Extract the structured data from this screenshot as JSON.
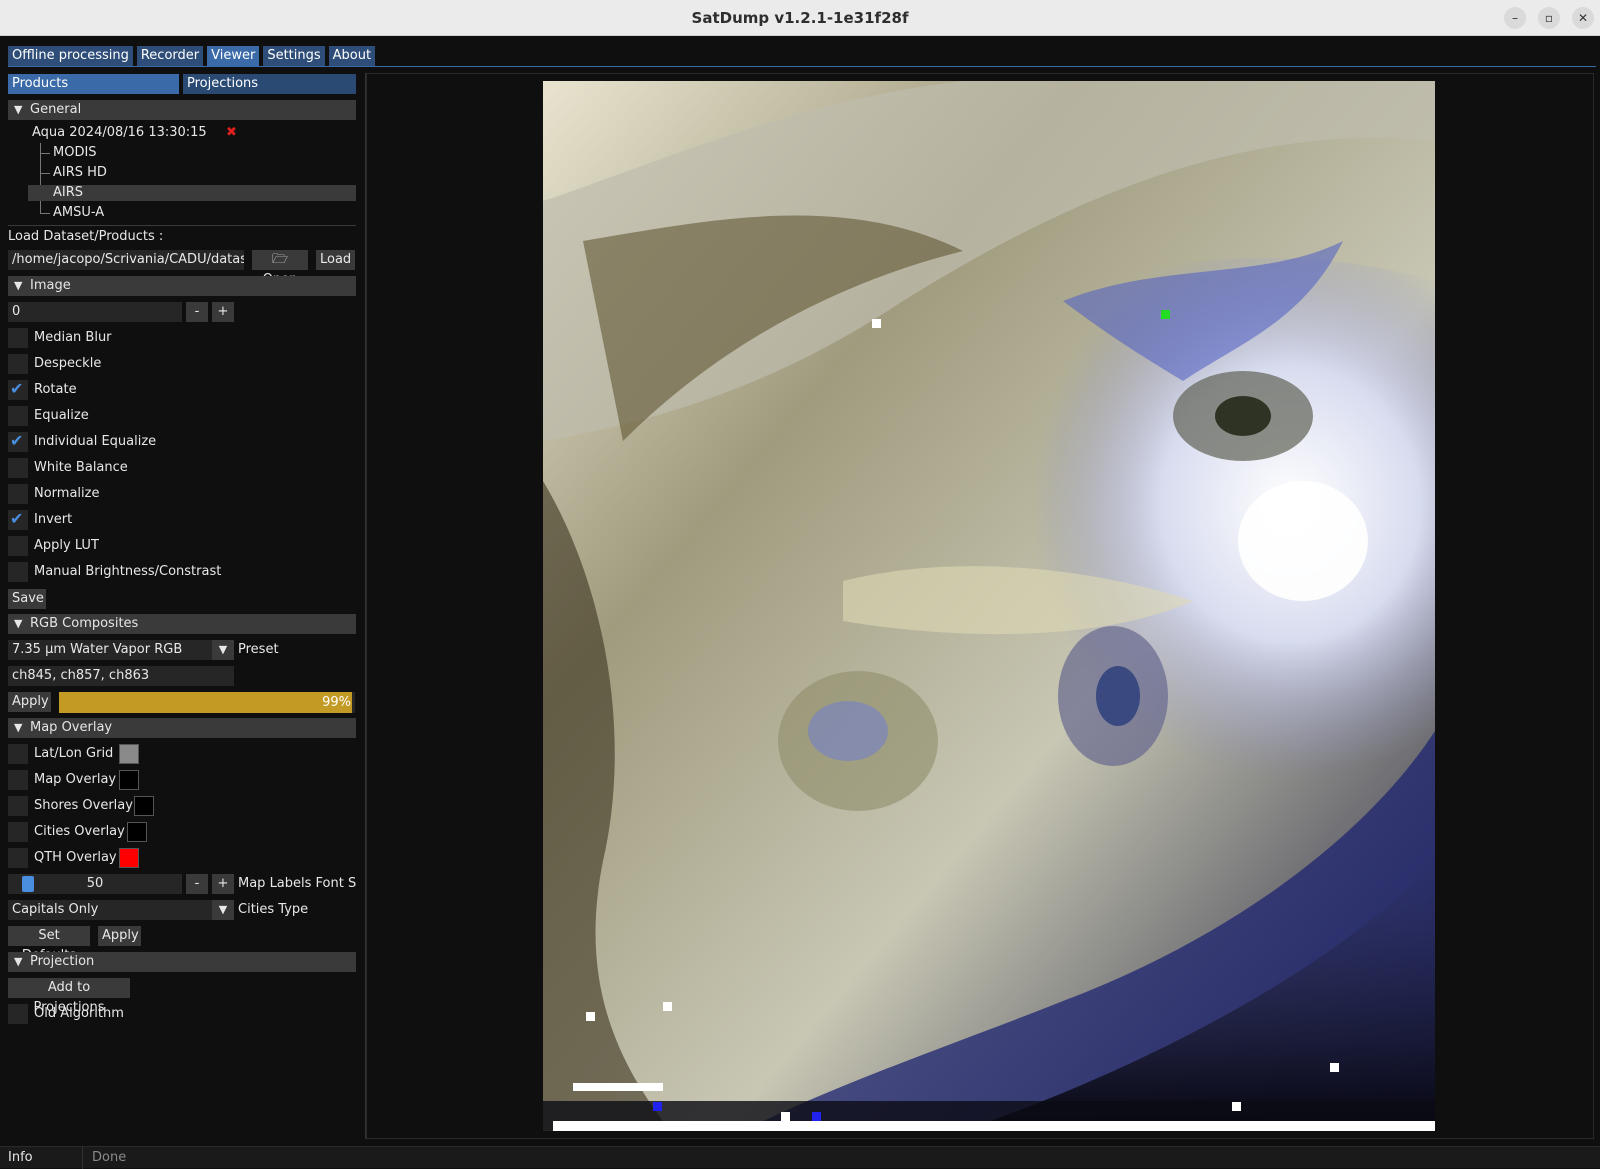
{
  "window": {
    "title": "SatDump v1.2.1-1e31f28f"
  },
  "main_tabs": [
    "Offline processing",
    "Recorder",
    "Viewer",
    "Settings",
    "About"
  ],
  "sub_tabs": [
    "Products",
    "Projections"
  ],
  "general": {
    "header": "General",
    "dataset": "Aqua 2024/08/16 13:30:15",
    "instruments": [
      "MODIS",
      "AIRS HD",
      "AIRS",
      "AMSU-A"
    ],
    "selected_instrument": "AIRS"
  },
  "load": {
    "label": "Load Dataset/Products :",
    "path": "/home/jacopo/Scrivania/CADU/datase",
    "open": "Open",
    "load": "Load"
  },
  "image": {
    "header": "Image",
    "channel_value": "0",
    "minus": "-",
    "plus": "+",
    "options": [
      {
        "label": "Median Blur",
        "checked": false
      },
      {
        "label": "Despeckle",
        "checked": false
      },
      {
        "label": "Rotate",
        "checked": true
      },
      {
        "label": "Equalize",
        "checked": false
      },
      {
        "label": "Individual Equalize",
        "checked": true
      },
      {
        "label": "White Balance",
        "checked": false
      },
      {
        "label": "Normalize",
        "checked": false
      },
      {
        "label": "Invert",
        "checked": true
      },
      {
        "label": "Apply LUT",
        "checked": false
      },
      {
        "label": "Manual Brightness/Constrast",
        "checked": false
      }
    ],
    "save": "Save"
  },
  "rgb": {
    "header": "RGB Composites",
    "preset_value": "7.35 µm Water Vapor RGB",
    "preset_label": "Preset",
    "channels": "ch845, ch857, ch863",
    "apply": "Apply",
    "progress": 0.99,
    "progress_text": "99%",
    "progress_color": "#c39a24"
  },
  "map_overlay": {
    "header": "Map Overlay",
    "items": [
      {
        "label": "Lat/Lon Grid",
        "color": "#8a8a8a"
      },
      {
        "label": "Map Overlay",
        "color": "#000000"
      },
      {
        "label": "Shores Overlay",
        "color": "#000000"
      },
      {
        "label": "Cities Overlay",
        "color": "#000000"
      },
      {
        "label": "QTH Overlay",
        "color": "#ff0000"
      }
    ],
    "font_size_value": "50",
    "font_size_label": "Map Labels Font Si:",
    "cities_type_value": "Capitals Only",
    "cities_type_label": "Cities Type",
    "set_defaults": "Set Defaults",
    "apply": "Apply"
  },
  "projection": {
    "header": "Projection",
    "add": "Add to Projections",
    "old_algorithm": "Old Algorithm"
  },
  "status": {
    "label": "Info",
    "text": "Done"
  },
  "icons": {
    "collapse": "triangle-down-icon",
    "remove": "red-x-icon",
    "folder": "folder-icon",
    "check": "checkmark-icon"
  }
}
